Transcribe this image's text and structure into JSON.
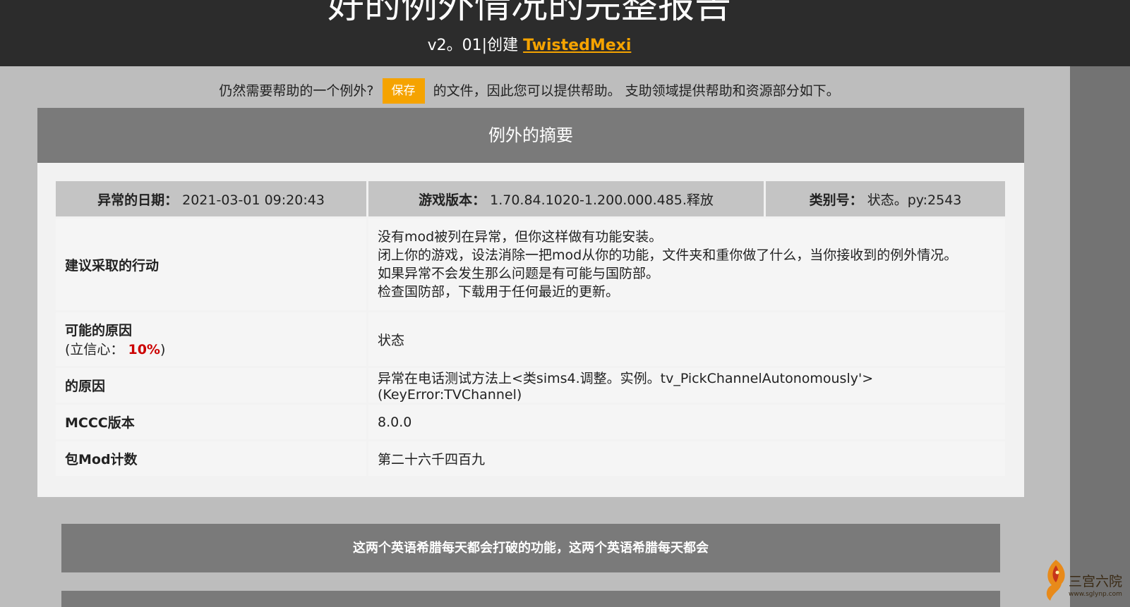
{
  "header": {
    "title": "好的例外情况的完整报告",
    "version": "v2。01|创建",
    "author": "TwistedMexi"
  },
  "notice": {
    "before": "仍然需要帮助的一个例外?",
    "save_label": "保存",
    "after": "的文件，因此您可以提供帮助。 支助领域提供帮助和资源部分如下。"
  },
  "summary": {
    "title": "例外的摘要",
    "date_label": "异常的日期：",
    "date_value": "2021-03-01 09:20:43",
    "game_version_label": "游戏版本：",
    "game_version_value": "1.70.84.1020-1.200.000.485.释放",
    "category_label": "类别号：",
    "category_value": "状态。py:2543",
    "rows": {
      "action_label": "建议采取的行动",
      "action_lines": [
        "没有mod被列在异常，但你这样做有功能安装。",
        "闭上你的游戏，设法消除一把mod从你的功能，文件夹和重你做了什么，当你接收到的例外情况。",
        "如果异常不会发生那么问题是有可能与国防部。",
        "检查国防部，下载用于任何最近的更新。"
      ],
      "possible_cause_label": "可能的原因",
      "confidence_prefix": "(立信心：",
      "confidence_value": "10%",
      "confidence_suffix": ")",
      "possible_cause_value": "状态",
      "cause_label": "的原因",
      "cause_value": "异常在电话测试方法上<类sims4.调整。实例。tv_PickChannelAutonomously'>(KeyError:TVChannel)",
      "mccc_label": "MCCC版本",
      "mccc_value": "8.0.0",
      "mod_count_label": "包Mod计数",
      "mod_count_value": "第二十六千四百九"
    }
  },
  "section_bar": {
    "text": "这两个英语希腊每天都会打破的功能，这两个英语希腊每天都会"
  },
  "watermark": {
    "text": "三宫六院",
    "url": "www.sglynp.com"
  },
  "colors": {
    "accent": "#f5a300",
    "confidence": "#cc0000",
    "header_bg": "#2c2c2c",
    "panel_head": "#7a7a7a"
  }
}
